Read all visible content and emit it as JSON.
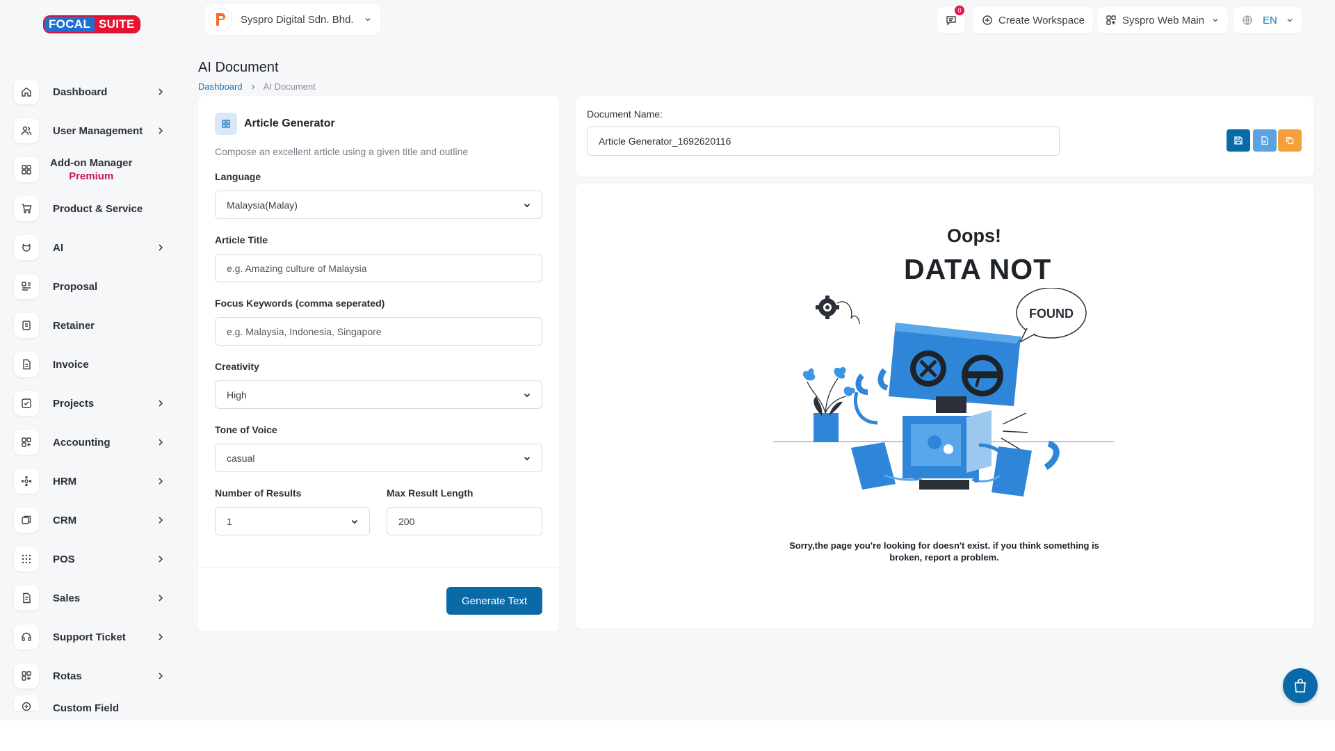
{
  "logo": {
    "part1": "FOCAL",
    "part2": "SUITE"
  },
  "topbar": {
    "company_name": "Syspro Digital Sdn. Bhd.",
    "messages_count": "0",
    "create_workspace": "Create Workspace",
    "workspace_name": "Syspro Web Main",
    "language": "EN"
  },
  "sidebar": {
    "items": [
      {
        "label": "Dashboard",
        "icon": "home-icon",
        "has_children": true
      },
      {
        "label": "User Management",
        "icon": "users-icon",
        "has_children": true
      },
      {
        "label": "Add-on Manager",
        "sub": "Premium",
        "icon": "grid-icon",
        "has_children": false
      },
      {
        "label": "Product & Service",
        "icon": "cart-icon",
        "has_children": false
      },
      {
        "label": "AI",
        "icon": "ai-icon",
        "has_children": true
      },
      {
        "label": "Proposal",
        "icon": "proposal-icon",
        "has_children": false
      },
      {
        "label": "Retainer",
        "icon": "retainer-icon",
        "has_children": false
      },
      {
        "label": "Invoice",
        "icon": "invoice-icon",
        "has_children": false
      },
      {
        "label": "Projects",
        "icon": "projects-icon",
        "has_children": true
      },
      {
        "label": "Accounting",
        "icon": "accounting-icon",
        "has_children": true
      },
      {
        "label": "HRM",
        "icon": "hrm-icon",
        "has_children": true
      },
      {
        "label": "CRM",
        "icon": "crm-icon",
        "has_children": true
      },
      {
        "label": "POS",
        "icon": "pos-icon",
        "has_children": true
      },
      {
        "label": "Sales",
        "icon": "sales-icon",
        "has_children": true
      },
      {
        "label": "Support Ticket",
        "icon": "headset-icon",
        "has_children": true
      },
      {
        "label": "Rotas",
        "icon": "rotas-icon",
        "has_children": true
      },
      {
        "label": "Custom Field",
        "icon": "plus-circle-icon",
        "has_children": false
      }
    ]
  },
  "page": {
    "title": "AI Document",
    "breadcrumb": [
      "Dashboard",
      "AI Document"
    ]
  },
  "form": {
    "title": "Article Generator",
    "description": "Compose an excellent article using a given title and outline",
    "language_label": "Language",
    "language_value": "Malaysia(Malay)",
    "article_title_label": "Article Title",
    "article_title_placeholder": "e.g. Amazing culture of Malaysia",
    "keywords_label": "Focus Keywords (comma seperated)",
    "keywords_placeholder": "e.g. Malaysia, Indonesia, Singapore",
    "creativity_label": "Creativity",
    "creativity_value": "High",
    "tone_label": "Tone of Voice",
    "tone_value": "casual",
    "num_results_label": "Number of Results",
    "num_results_value": "1",
    "max_length_label": "Max Result Length",
    "max_length_value": "200",
    "generate_button": "Generate Text"
  },
  "document": {
    "name_label": "Document Name:",
    "name_value": "Article Generator_1692620116",
    "colors": {
      "save": "#0a6aa8",
      "download": "#5aa3e0",
      "copy": "#f5a03a"
    }
  },
  "empty_state": {
    "oops": "Oops!",
    "headline": "DATA NOT",
    "bubble": "FOUND",
    "message": "Sorry,the page you're looking for doesn't exist. if you think something is broken, report a problem."
  },
  "colors": {
    "primary": "#0a6aa8",
    "premium": "#c2185b",
    "badge": "#e8144a"
  }
}
